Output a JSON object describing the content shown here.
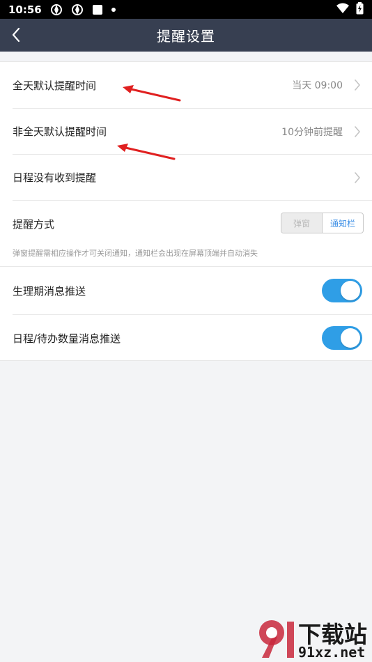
{
  "status_bar": {
    "time": "10:56"
  },
  "nav": {
    "title": "提醒设置"
  },
  "settings": {
    "allday_label": "全天默认提醒时间",
    "allday_value": "当天 09:00",
    "nonallday_label": "非全天默认提醒时间",
    "nonallday_value": "10分钟前提醒",
    "no_reminder_label": "日程没有收到提醒",
    "method_label": "提醒方式",
    "method_options": [
      "弹窗",
      "通知栏"
    ],
    "method_selected": "弹窗",
    "method_hint": "弹窗提醒需相应操作才可关闭通知，通知栏会出现在屏幕顶端并自动消失",
    "period_push_label": "生理期消息推送",
    "period_push_on": true,
    "todo_push_label": "日程/待办数量消息推送",
    "todo_push_on": true
  },
  "colors": {
    "navbar": "#373f51",
    "accent": "#2f9ee6",
    "annotation": "#e02020"
  },
  "watermark": {
    "logo_text": "下载站",
    "domain": "91xz.net"
  }
}
